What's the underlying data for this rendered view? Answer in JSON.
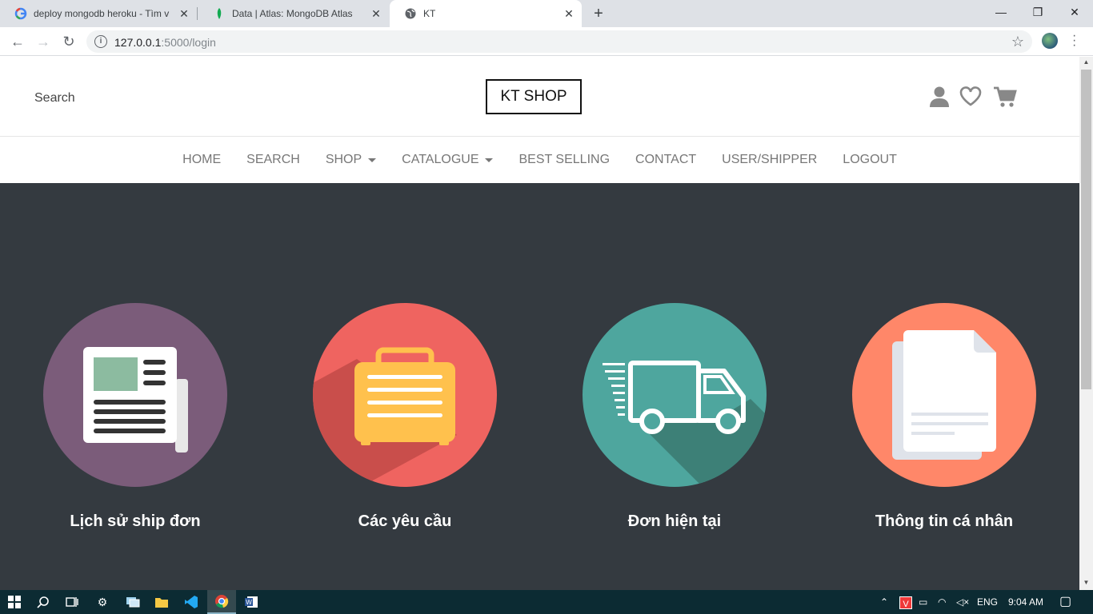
{
  "browser": {
    "tabs": [
      {
        "title": "deploy mongodb heroku - Tìm v",
        "icon": "google-icon"
      },
      {
        "title": "Data | Atlas: MongoDB Atlas",
        "icon": "mongodb-leaf-icon"
      },
      {
        "title": "KT",
        "icon": "globe-icon"
      }
    ],
    "url_host": "127.0.0.1",
    "url_rest": ":5000/login"
  },
  "site": {
    "search_label": "Search",
    "brand": "KT SHOP",
    "nav": [
      {
        "label": "HOME",
        "dropdown": false
      },
      {
        "label": "SEARCH",
        "dropdown": false
      },
      {
        "label": "SHOP",
        "dropdown": true
      },
      {
        "label": "CATALOGUE",
        "dropdown": true
      },
      {
        "label": "BEST SELLING",
        "dropdown": false
      },
      {
        "label": "CONTACT",
        "dropdown": false
      },
      {
        "label": "USER/SHIPPER",
        "dropdown": false
      },
      {
        "label": "LOGOUT",
        "dropdown": false
      }
    ]
  },
  "cards": [
    {
      "label": "Lịch sử ship đơn",
      "icon": "newspaper-icon",
      "color": "#7b5c7a"
    },
    {
      "label": "Các yêu cầu",
      "icon": "briefcase-icon",
      "color": "#ef6460"
    },
    {
      "label": "Đơn hiện tại",
      "icon": "delivery-truck-icon",
      "color": "#4ea69e"
    },
    {
      "label": "Thông tin cá nhân",
      "icon": "document-icon",
      "color": "#ff8769"
    }
  ],
  "taskbar": {
    "lang": "ENG",
    "time": "9:04 AM"
  }
}
